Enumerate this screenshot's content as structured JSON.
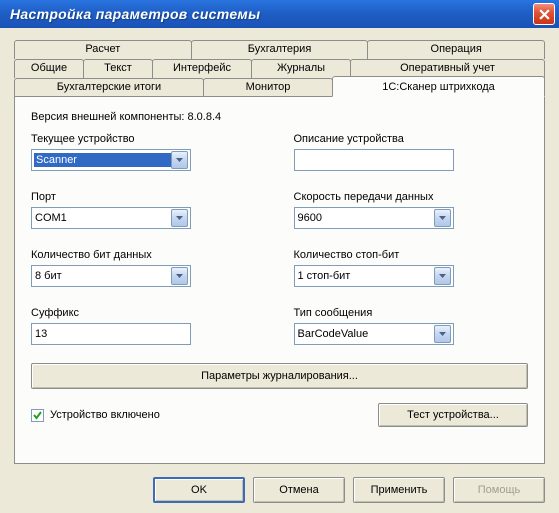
{
  "window": {
    "title": "Настройка параметров системы"
  },
  "tabs": {
    "row1": [
      "Расчет",
      "Бухгалтерия",
      "Операция"
    ],
    "row2": [
      "Общие",
      "Текст",
      "Интерфейс",
      "Журналы",
      "Оперативный учет"
    ],
    "row3": [
      "Бухгалтерские итоги",
      "Монитор",
      "1С:Сканер штрихкода"
    ],
    "active": "1С:Сканер штрихкода"
  },
  "panel": {
    "version_label": "Версия внешней компоненты: 8.0.8.4",
    "labels": {
      "device": "Текущее устройство",
      "description": "Описание устройства",
      "port": "Порт",
      "baud": "Скорость передачи данных",
      "databits": "Количество бит данных",
      "stopbits": "Количество стоп-бит",
      "suffix": "Суффикс",
      "msgtype": "Тип сообщения"
    },
    "values": {
      "device": "Scanner",
      "description": "",
      "port": "COM1",
      "baud": "9600",
      "databits": "8 бит",
      "stopbits": "1 стоп-бит",
      "suffix": "13",
      "msgtype": "BarCodeValue"
    },
    "journal_params_btn": "Параметры журналирования...",
    "enabled_checkbox": "Устройство включено",
    "test_btn": "Тест устройства..."
  },
  "buttons": {
    "ok": "OK",
    "cancel": "Отмена",
    "apply": "Применить",
    "help": "Помощь"
  }
}
